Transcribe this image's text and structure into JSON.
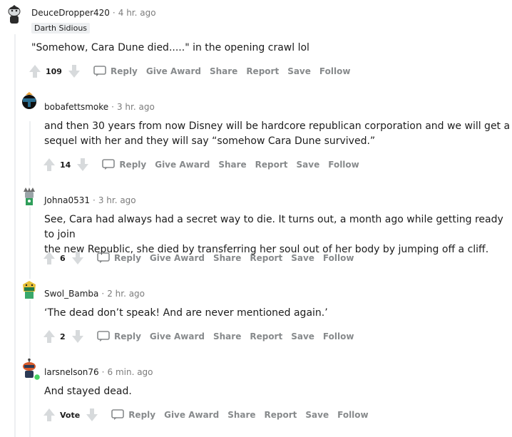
{
  "action_labels": {
    "reply": "Reply",
    "give_award": "Give Award",
    "share": "Share",
    "report": "Report",
    "save": "Save",
    "follow": "Follow"
  },
  "comments": [
    {
      "author": "DeuceDropper420",
      "time": "4 hr. ago",
      "flair": "Darth Sidious",
      "text": "\"Somehow, Cara Dune died.....\" in the opening crawl lol",
      "score": "109"
    },
    {
      "author": "bobafettsmoke",
      "time": "3 hr. ago",
      "text": "and then 30 years from now Disney will be hardcore republican corporation and we will get a\nsequel with her and they will say “somehow Cara Dune survived.”",
      "score": "14"
    },
    {
      "author": "Johna0531",
      "time": "3 hr. ago",
      "text": "See, Cara had always had a secret way to die. It turns out, a month ago while getting ready to join\nthe new Republic, she died by transferring her soul out of her body by jumping off a cliff.",
      "score": "6"
    },
    {
      "author": "Swol_Bamba",
      "time": "2 hr. ago",
      "text": "‘The dead don’t speak! And are never mentioned again.’",
      "score": "2"
    },
    {
      "author": "larsnelson76",
      "time": "6 min. ago",
      "text": "And stayed dead.",
      "score": "Vote"
    }
  ]
}
